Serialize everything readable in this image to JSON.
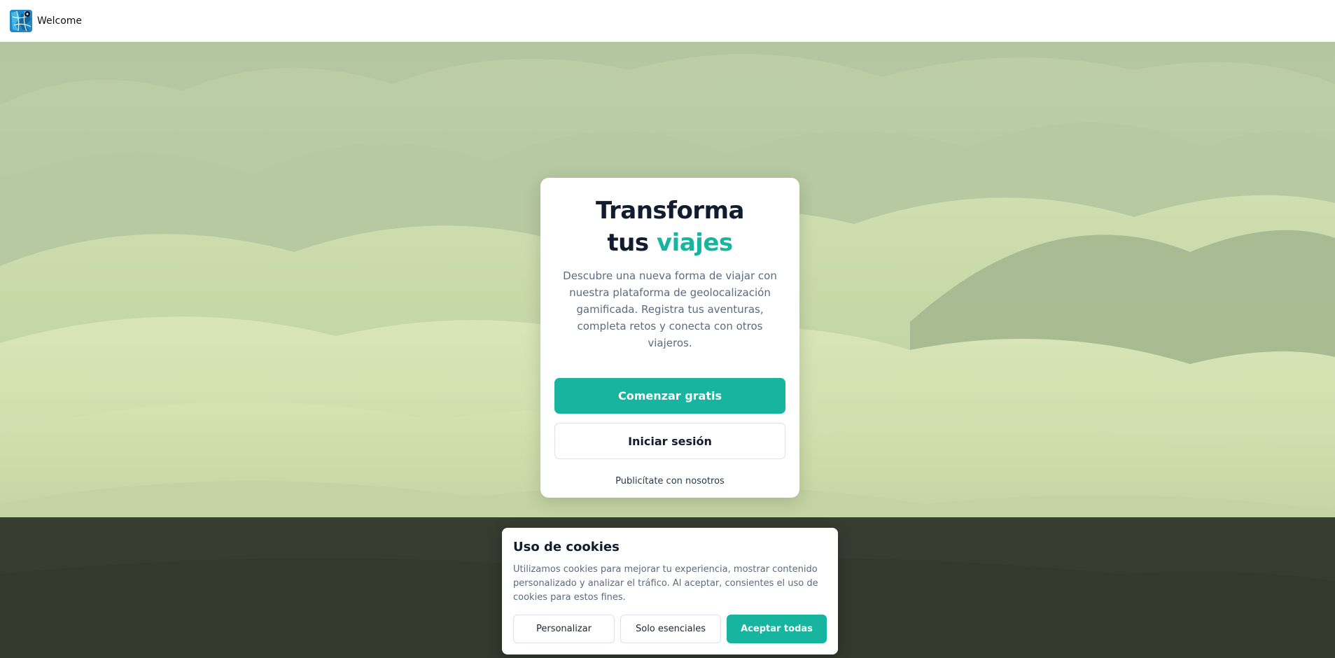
{
  "app": {
    "title": "Welcome",
    "logo_icon": "travel-map-logo-icon"
  },
  "hero": {
    "headline_line1": "Transforma",
    "headline_line2_start": "tus",
    "headline_line2_accent": "viajes",
    "description": "Descubre una nueva forma de viajar con nuestra plataforma de geolocalización gamificada. Registra tus aventuras, completa retos y conecta con otros viajeros.",
    "primary_button": "Comenzar gratis",
    "secondary_button": "Iniciar sesión",
    "advertise_link": "Publicítate con nosotros",
    "background": "green-hills-landscape"
  },
  "cookies": {
    "title": "Uso de cookies",
    "text": "Utilizamos cookies para mejorar tu experiencia, mostrar contenido personalizado y analizar el tráfico. Al aceptar, consientes el uso de cookies para estos fines.",
    "customize_button": "Personalizar",
    "essentials_button": "Solo esenciales",
    "accept_button": "Aceptar todas"
  },
  "colors": {
    "accent": "#17b5a0",
    "heading": "#111c2e",
    "body_text": "#5c6b7e"
  }
}
